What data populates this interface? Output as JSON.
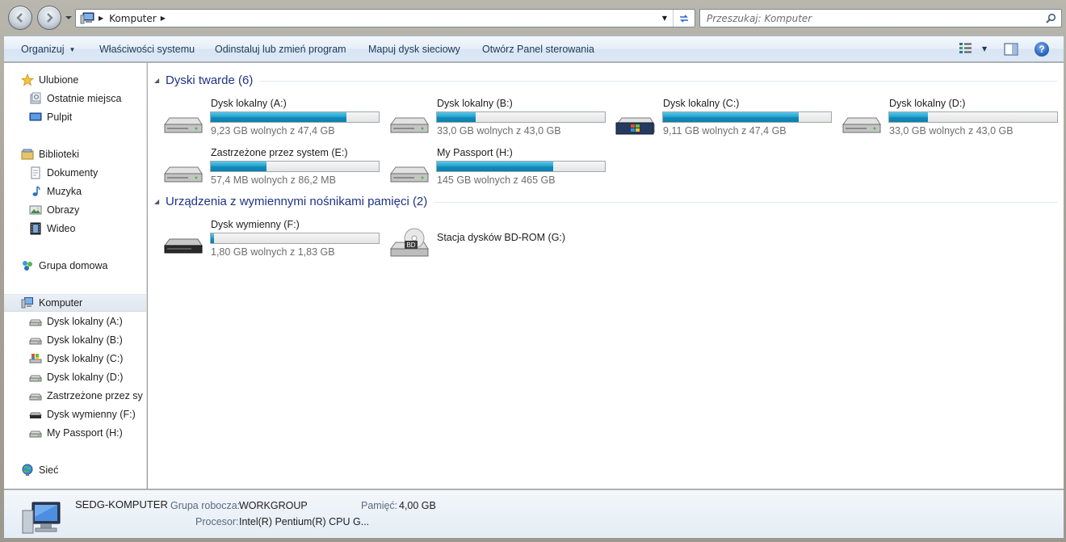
{
  "address": {
    "path": "Komputer",
    "search_placeholder": "Przeszukaj: Komputer"
  },
  "toolbar": {
    "organize": "Organizuj",
    "properties": "Właściwości systemu",
    "uninstall": "Odinstaluj lub zmień program",
    "map_drive": "Mapuj dysk sieciowy",
    "control_panel": "Otwórz Panel sterowania"
  },
  "sidebar": {
    "favorites": "Ulubione",
    "recent": "Ostatnie miejsca",
    "desktop": "Pulpit",
    "libraries": "Biblioteki",
    "documents": "Dokumenty",
    "music": "Muzyka",
    "pictures": "Obrazy",
    "videos": "Wideo",
    "homegroup": "Grupa domowa",
    "computer": "Komputer",
    "drives": [
      "Dysk lokalny (A:)",
      "Dysk lokalny (B:)",
      "Dysk lokalny (C:)",
      "Dysk lokalny (D:)",
      "Zastrzeżone przez sy",
      "Dysk wymienny (F:)",
      "My Passport (H:)"
    ],
    "network": "Sieć"
  },
  "groups": {
    "hard_drives": "Dyski twarde (6)",
    "removable": "Urządzenia z wymiennymi nośnikami pamięci (2)"
  },
  "drives": [
    {
      "name": "Dysk lokalny (A:)",
      "free": "9,23 GB wolnych z 47,4 GB",
      "used_fraction": 0.81
    },
    {
      "name": "Dysk lokalny (B:)",
      "free": "33,0 GB wolnych z 43,0 GB",
      "used_fraction": 0.23
    },
    {
      "name": "Dysk lokalny (C:)",
      "free": "9,11 GB wolnych z 47,4 GB",
      "used_fraction": 0.81
    },
    {
      "name": "Dysk lokalny (D:)",
      "free": "33,0 GB wolnych z 43,0 GB",
      "used_fraction": 0.23
    },
    {
      "name": "Zastrzeżone przez system (E:)",
      "free": "57,4 MB wolnych z 86,2 MB",
      "used_fraction": 0.33
    },
    {
      "name": "My Passport (H:)",
      "free": "145 GB wolnych z 465 GB",
      "used_fraction": 0.69
    }
  ],
  "removable": [
    {
      "name": "Dysk wymienny (F:)",
      "free": "1,80 GB wolnych z 1,83 GB",
      "used_fraction": 0.02
    },
    {
      "name": "Stacja dysków BD-ROM (G:)"
    }
  ],
  "details": {
    "computer_name": "SEDG-KOMPUTER",
    "workgroup_label": "Grupa robocza:",
    "workgroup_value": "WORKGROUP",
    "memory_label": "Pamięć:",
    "memory_value": "4,00 GB",
    "cpu_label": "Procesor:",
    "cpu_value": "Intel(R) Pentium(R) CPU G..."
  },
  "colors": {
    "bar_fill": "#1a9bc8",
    "group_title": "#1e3287"
  }
}
